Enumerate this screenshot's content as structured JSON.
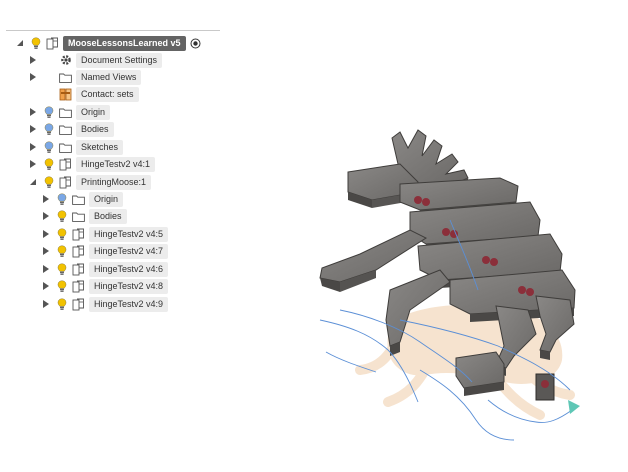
{
  "browser": {
    "items": [
      {
        "label": "MooseLessonsLearned v5",
        "kind": "root",
        "bulb": "yellow",
        "icon": "component-icon"
      },
      {
        "label": "Document Settings",
        "kind": "closed",
        "bulb": "none",
        "icon": "gear-icon"
      },
      {
        "label": "Named Views",
        "kind": "closed",
        "bulb": "none",
        "icon": "folder-icon"
      },
      {
        "label": "Contact: sets",
        "kind": "none",
        "bulb": "none",
        "icon": "joint-icon"
      },
      {
        "label": "Origin",
        "kind": "closed",
        "bulb": "blue",
        "icon": "folder-icon"
      },
      {
        "label": "Bodies",
        "kind": "closed",
        "bulb": "blue",
        "icon": "folder-icon"
      },
      {
        "label": "Sketches",
        "kind": "closed",
        "bulb": "blue",
        "icon": "folder-icon"
      },
      {
        "label": "HingeTestv2 v4:1",
        "kind": "closed",
        "bulb": "yellow",
        "icon": "component-icon"
      },
      {
        "label": "PrintingMoose:1",
        "kind": "open",
        "bulb": "yellow",
        "icon": "component-icon"
      },
      {
        "label": "Origin",
        "kind": "closed",
        "bulb": "blue",
        "icon": "folder-icon"
      },
      {
        "label": "Bodies",
        "kind": "closed",
        "bulb": "yellow",
        "icon": "folder-icon"
      },
      {
        "label": "HingeTestv2 v4:5",
        "kind": "closed",
        "bulb": "yellow",
        "icon": "component-icon"
      },
      {
        "label": "HingeTestv2 v4:7",
        "kind": "closed",
        "bulb": "yellow",
        "icon": "component-icon"
      },
      {
        "label": "HingeTestv2 v4:6",
        "kind": "closed",
        "bulb": "yellow",
        "icon": "component-icon"
      },
      {
        "label": "HingeTestv2 v4:8",
        "kind": "closed",
        "bulb": "yellow",
        "icon": "component-icon"
      },
      {
        "label": "HingeTestv2 v4:9",
        "kind": "closed",
        "bulb": "yellow",
        "icon": "component-icon"
      }
    ]
  },
  "colors": {
    "bulb_on": "#f2c200",
    "bulb_hidden": "#7aa7e6",
    "root_label_bg": "#646464",
    "label_bg": "#ececec",
    "body_top": "#7a7876",
    "body_side": "#4a4846",
    "sketch_line": "#5b8fd6",
    "ghost_fill": "#f6e3cf"
  }
}
